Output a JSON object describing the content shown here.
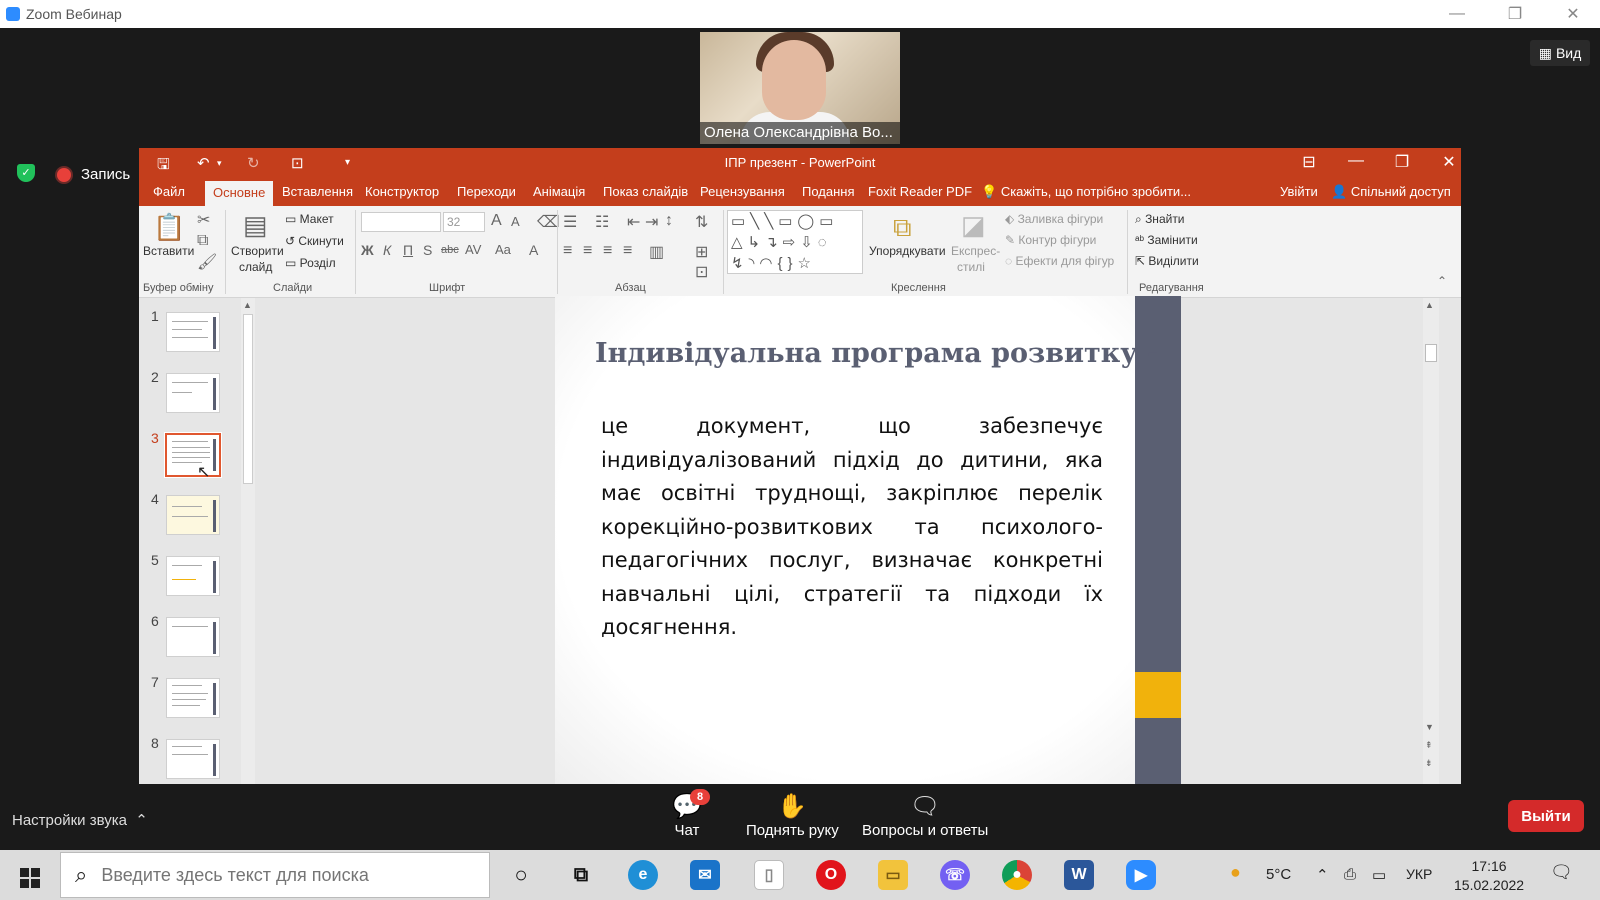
{
  "zoom": {
    "window_title": "Zoom Вебинар",
    "participant_name": "Олена Олександрівна Во...",
    "view_label": "Вид",
    "record_label": "Запись",
    "sound_settings": "Настройки звука",
    "controls": [
      {
        "label": "Чат",
        "badge": "8"
      },
      {
        "label": "Поднять руку"
      },
      {
        "label": "Вопросы и ответы"
      }
    ],
    "exit_label": "Выйти"
  },
  "ppt": {
    "title": "ІПР презент - PowerPoint",
    "tabs": [
      "Файл",
      "Основне",
      "Вставлення",
      "Конструктор",
      "Переходи",
      "Анімація",
      "Показ слайдів",
      "Рецензування",
      "Подання",
      "Foxit Reader PDF"
    ],
    "tell_me": "Скажіть, що потрібно зробити...",
    "signin": "Увійти",
    "share": "Спільний доступ",
    "ribbon": {
      "paste": "Вставити",
      "clipboard_group": "Буфер обміну",
      "new_slide_1": "Створити",
      "new_slide_2": "слайд",
      "layout": "Макет",
      "reset": "Скинути",
      "section": "Розділ",
      "slides_group": "Слайди",
      "font_size": "32",
      "font_group": "Шрифт",
      "paragraph_group": "Абзац",
      "arrange": "Упорядкувати",
      "quick_styles_1": "Експрес-",
      "quick_styles_2": "стилі",
      "shape_fill": "Заливка фігури",
      "shape_outline": "Контур фігури",
      "shape_effects": "Ефекти для фігур",
      "drawing_group": "Креслення",
      "find": "Знайти",
      "replace": "Замінити",
      "select": "Виділити",
      "editing_group": "Редагування"
    },
    "thumbnails": [
      "1",
      "2",
      "3",
      "4",
      "5",
      "6",
      "7",
      "8"
    ],
    "selected_slide": "3",
    "slide": {
      "title": "Індивідуальна програма розвитку -",
      "body": " це документ, що забезпечує індивідуалізований підхід до дитини, яка має освітні труднощі, закріплює перелік корекційно-розвиткових та психолого-педагогічних послуг, визначає конкретні навчальні цілі, стратегії та підходи їх досягнення."
    }
  },
  "taskbar": {
    "search_placeholder": "Введите здесь текст для поиска",
    "weather": "5°C",
    "lang": "УКР",
    "time": "17:16",
    "date": "15.02.2022"
  },
  "colors": {
    "ppt_accent": "#c43e1c",
    "slide_bar": "#5a5f72",
    "slide_accent": "#f1b20c",
    "zoom_exit": "#d42a2a"
  }
}
